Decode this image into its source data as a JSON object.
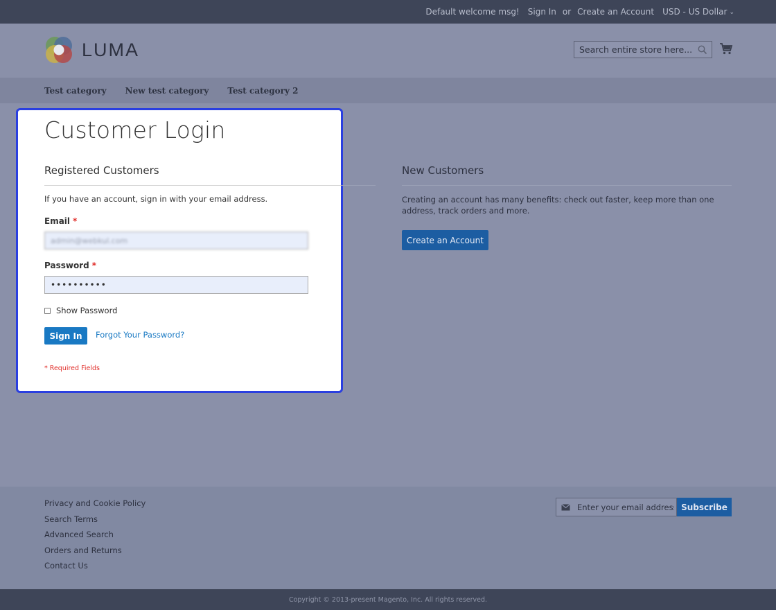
{
  "top_bar": {
    "welcome": "Default welcome msg!",
    "sign_in": "Sign In",
    "or": "or",
    "create_account": "Create an Account",
    "currency": "USD - US Dollar"
  },
  "header": {
    "logo_text": "LUMA",
    "search_placeholder": "Search entire store here..."
  },
  "nav": {
    "items": [
      "Test category",
      "New test category",
      "Test category 2"
    ]
  },
  "main": {
    "page_title": "Customer Login",
    "registered": {
      "title": "Registered Customers",
      "intro": "If you have an account, sign in with your email address.",
      "email_label": "Email",
      "email_value": "admin@webkul.com",
      "password_label": "Password",
      "password_value": "••••••••••",
      "required_marker": "*",
      "show_password": "Show Password",
      "sign_in_button": "Sign In",
      "forgot_link": "Forgot Your Password?",
      "required_note": "* Required Fields"
    },
    "new_customers": {
      "title": "New Customers",
      "text": "Creating an account has many benefits: check out faster, keep more than one address, track orders and more.",
      "create_button": "Create an Account"
    }
  },
  "footer": {
    "links": [
      "Privacy and Cookie Policy",
      "Search Terms",
      "Advanced Search",
      "Orders and Returns",
      "Contact Us"
    ],
    "newsletter_placeholder": "Enter your email address",
    "subscribe_button": "Subscribe",
    "copyright": "Copyright © 2013-present Magento, Inc. All rights reserved."
  },
  "colors": {
    "overlay": "#8a90a9",
    "highlight_border": "#2a3fe0",
    "primary_button": "#1979c3",
    "required": "#e02b27"
  },
  "icons": [
    "search-icon",
    "cart-icon",
    "envelope-icon",
    "chevron-down-icon",
    "luma-logo-icon"
  ]
}
